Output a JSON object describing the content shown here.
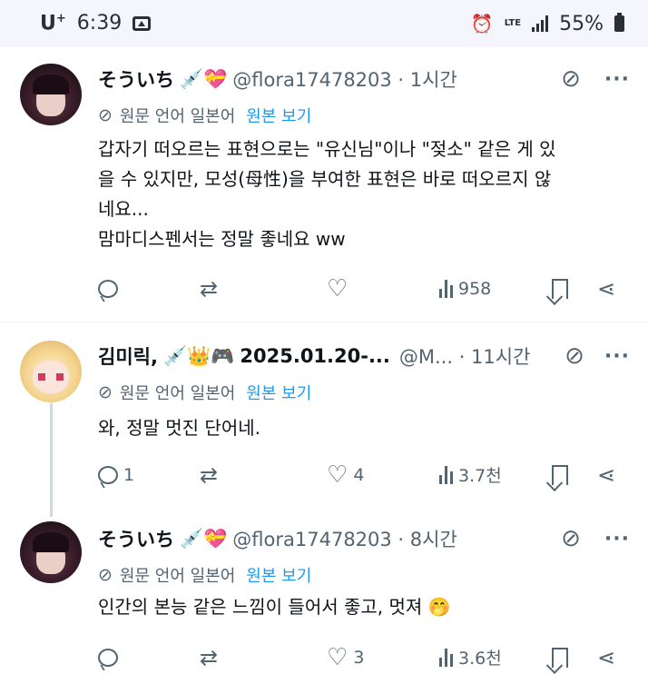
{
  "status_bar": {
    "carrier": "U",
    "carrier_sup": "+",
    "time": "6:39",
    "network": "LTE",
    "battery": "55%"
  },
  "tweets": [
    {
      "name": "そういち",
      "badges": "💉💝",
      "handle": "@flora17478203 · 1시간",
      "translate_label": "원문 언어 일본어",
      "show_original": "원본 보기",
      "lines": [
        "갑자기 떠오르는 표현으로는 \"유신님\"이나 \"젖소\" 같은 게 있",
        "을 수 있지만, 모성(母性)을 부여한 표현은 바로 떠오르지 않",
        "네요...",
        "맘마디스펜서는 정말 좋네요 ww"
      ],
      "replies": "",
      "retweets": "",
      "likes": "",
      "views": "958"
    },
    {
      "name": "김미릭,",
      "badges": "💉👑🎮",
      "name_extra": "2025.01.20-...",
      "handle": "@M... · 11시간",
      "translate_label": "원문 언어 일본어",
      "show_original": "원본 보기",
      "lines": [
        "와, 정말 멋진 단어네."
      ],
      "replies": "1",
      "retweets": "",
      "likes": "4",
      "views": "3.7천"
    },
    {
      "name": "そういち",
      "badges": "💉💝",
      "handle": "@flora17478203 · 8시간",
      "translate_label": "원문 언어 일본어",
      "show_original": "원본 보기",
      "lines": [
        "인간의 본능 같은 느낌이 들어서 좋고, 멋져 🤭"
      ],
      "replies": "",
      "retweets": "",
      "likes": "3",
      "views": "3.6천"
    }
  ]
}
